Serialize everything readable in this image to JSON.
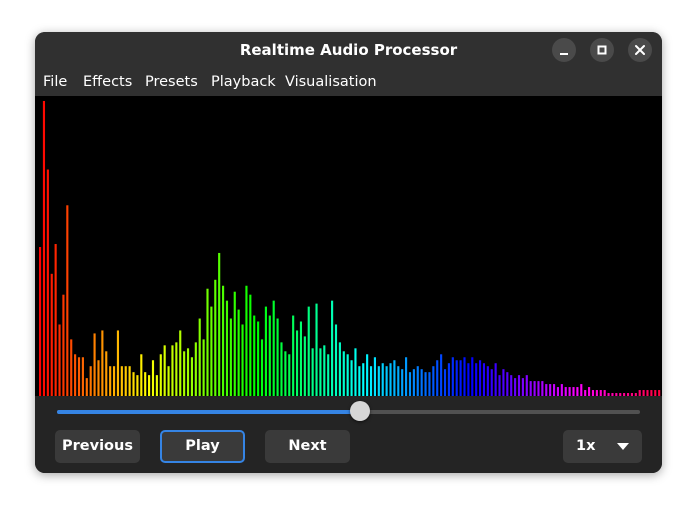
{
  "window": {
    "title": "Realtime Audio Processor",
    "controls": [
      "minimize",
      "maximize",
      "close"
    ]
  },
  "menu": {
    "items": [
      "File",
      "Effects",
      "Presets",
      "Playback",
      "Visualisation"
    ]
  },
  "visualiser": {
    "type": "frequency-spectrum-bars",
    "bar_levels": [
      0.5,
      0.99,
      0.76,
      0.41,
      0.51,
      0.24,
      0.34,
      0.64,
      0.19,
      0.14,
      0.13,
      0.13,
      0.06,
      0.1,
      0.21,
      0.12,
      0.22,
      0.15,
      0.1,
      0.1,
      0.22,
      0.1,
      0.1,
      0.1,
      0.08,
      0.07,
      0.14,
      0.08,
      0.07,
      0.12,
      0.07,
      0.14,
      0.17,
      0.1,
      0.17,
      0.18,
      0.22,
      0.15,
      0.16,
      0.13,
      0.18,
      0.26,
      0.19,
      0.36,
      0.3,
      0.39,
      0.48,
      0.37,
      0.32,
      0.26,
      0.35,
      0.29,
      0.24,
      0.37,
      0.34,
      0.27,
      0.25,
      0.19,
      0.3,
      0.27,
      0.32,
      0.26,
      0.18,
      0.15,
      0.14,
      0.27,
      0.22,
      0.25,
      0.2,
      0.3,
      0.16,
      0.31,
      0.16,
      0.17,
      0.14,
      0.32,
      0.24,
      0.18,
      0.15,
      0.14,
      0.12,
      0.16,
      0.1,
      0.11,
      0.14,
      0.1,
      0.13,
      0.1,
      0.11,
      0.1,
      0.11,
      0.12,
      0.1,
      0.09,
      0.13,
      0.08,
      0.09,
      0.1,
      0.09,
      0.08,
      0.08,
      0.1,
      0.12,
      0.14,
      0.09,
      0.11,
      0.13,
      0.12,
      0.12,
      0.13,
      0.11,
      0.13,
      0.11,
      0.12,
      0.11,
      0.1,
      0.09,
      0.11,
      0.07,
      0.09,
      0.08,
      0.07,
      0.06,
      0.07,
      0.06,
      0.07,
      0.05,
      0.05,
      0.05,
      0.05,
      0.04,
      0.04,
      0.04,
      0.03,
      0.04,
      0.03,
      0.03,
      0.03,
      0.03,
      0.04,
      0.02,
      0.03,
      0.02,
      0.02,
      0.02,
      0.02,
      0.01,
      0.01,
      0.01,
      0.01,
      0.01,
      0.01,
      0.01,
      0.01,
      0.02,
      0.02,
      0.02,
      0.02,
      0.02,
      0.02
    ],
    "hue_start": 0,
    "hue_end": 345
  },
  "playback": {
    "progress": 0.52,
    "accent_color": "#3584e4",
    "buttons": {
      "previous": "Previous",
      "play": "Play",
      "next": "Next"
    },
    "speed": {
      "selected": "1x"
    }
  }
}
